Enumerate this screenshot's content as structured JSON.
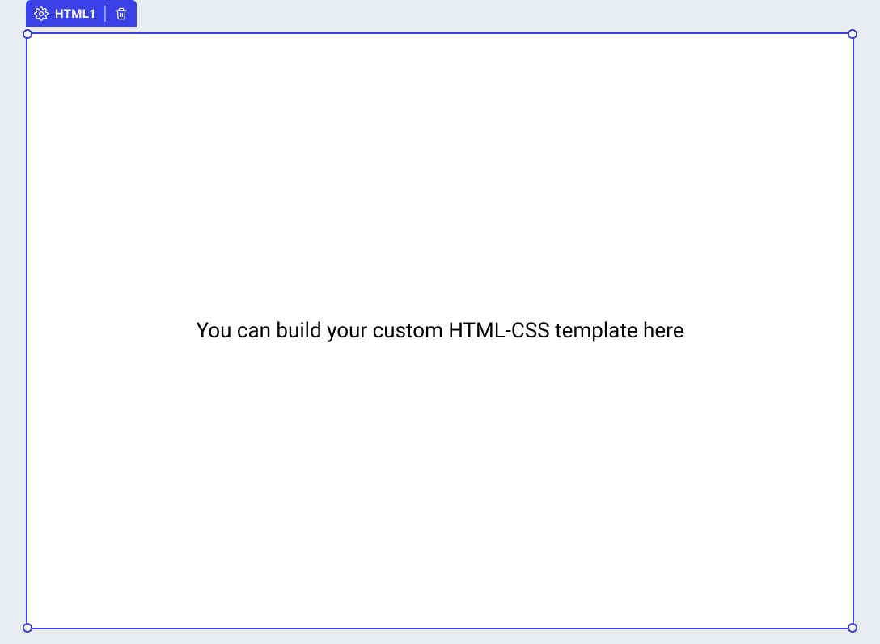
{
  "toolbar": {
    "tab_label": "HTML1"
  },
  "canvas": {
    "placeholder_text": "You can build your custom HTML-CSS template here"
  }
}
